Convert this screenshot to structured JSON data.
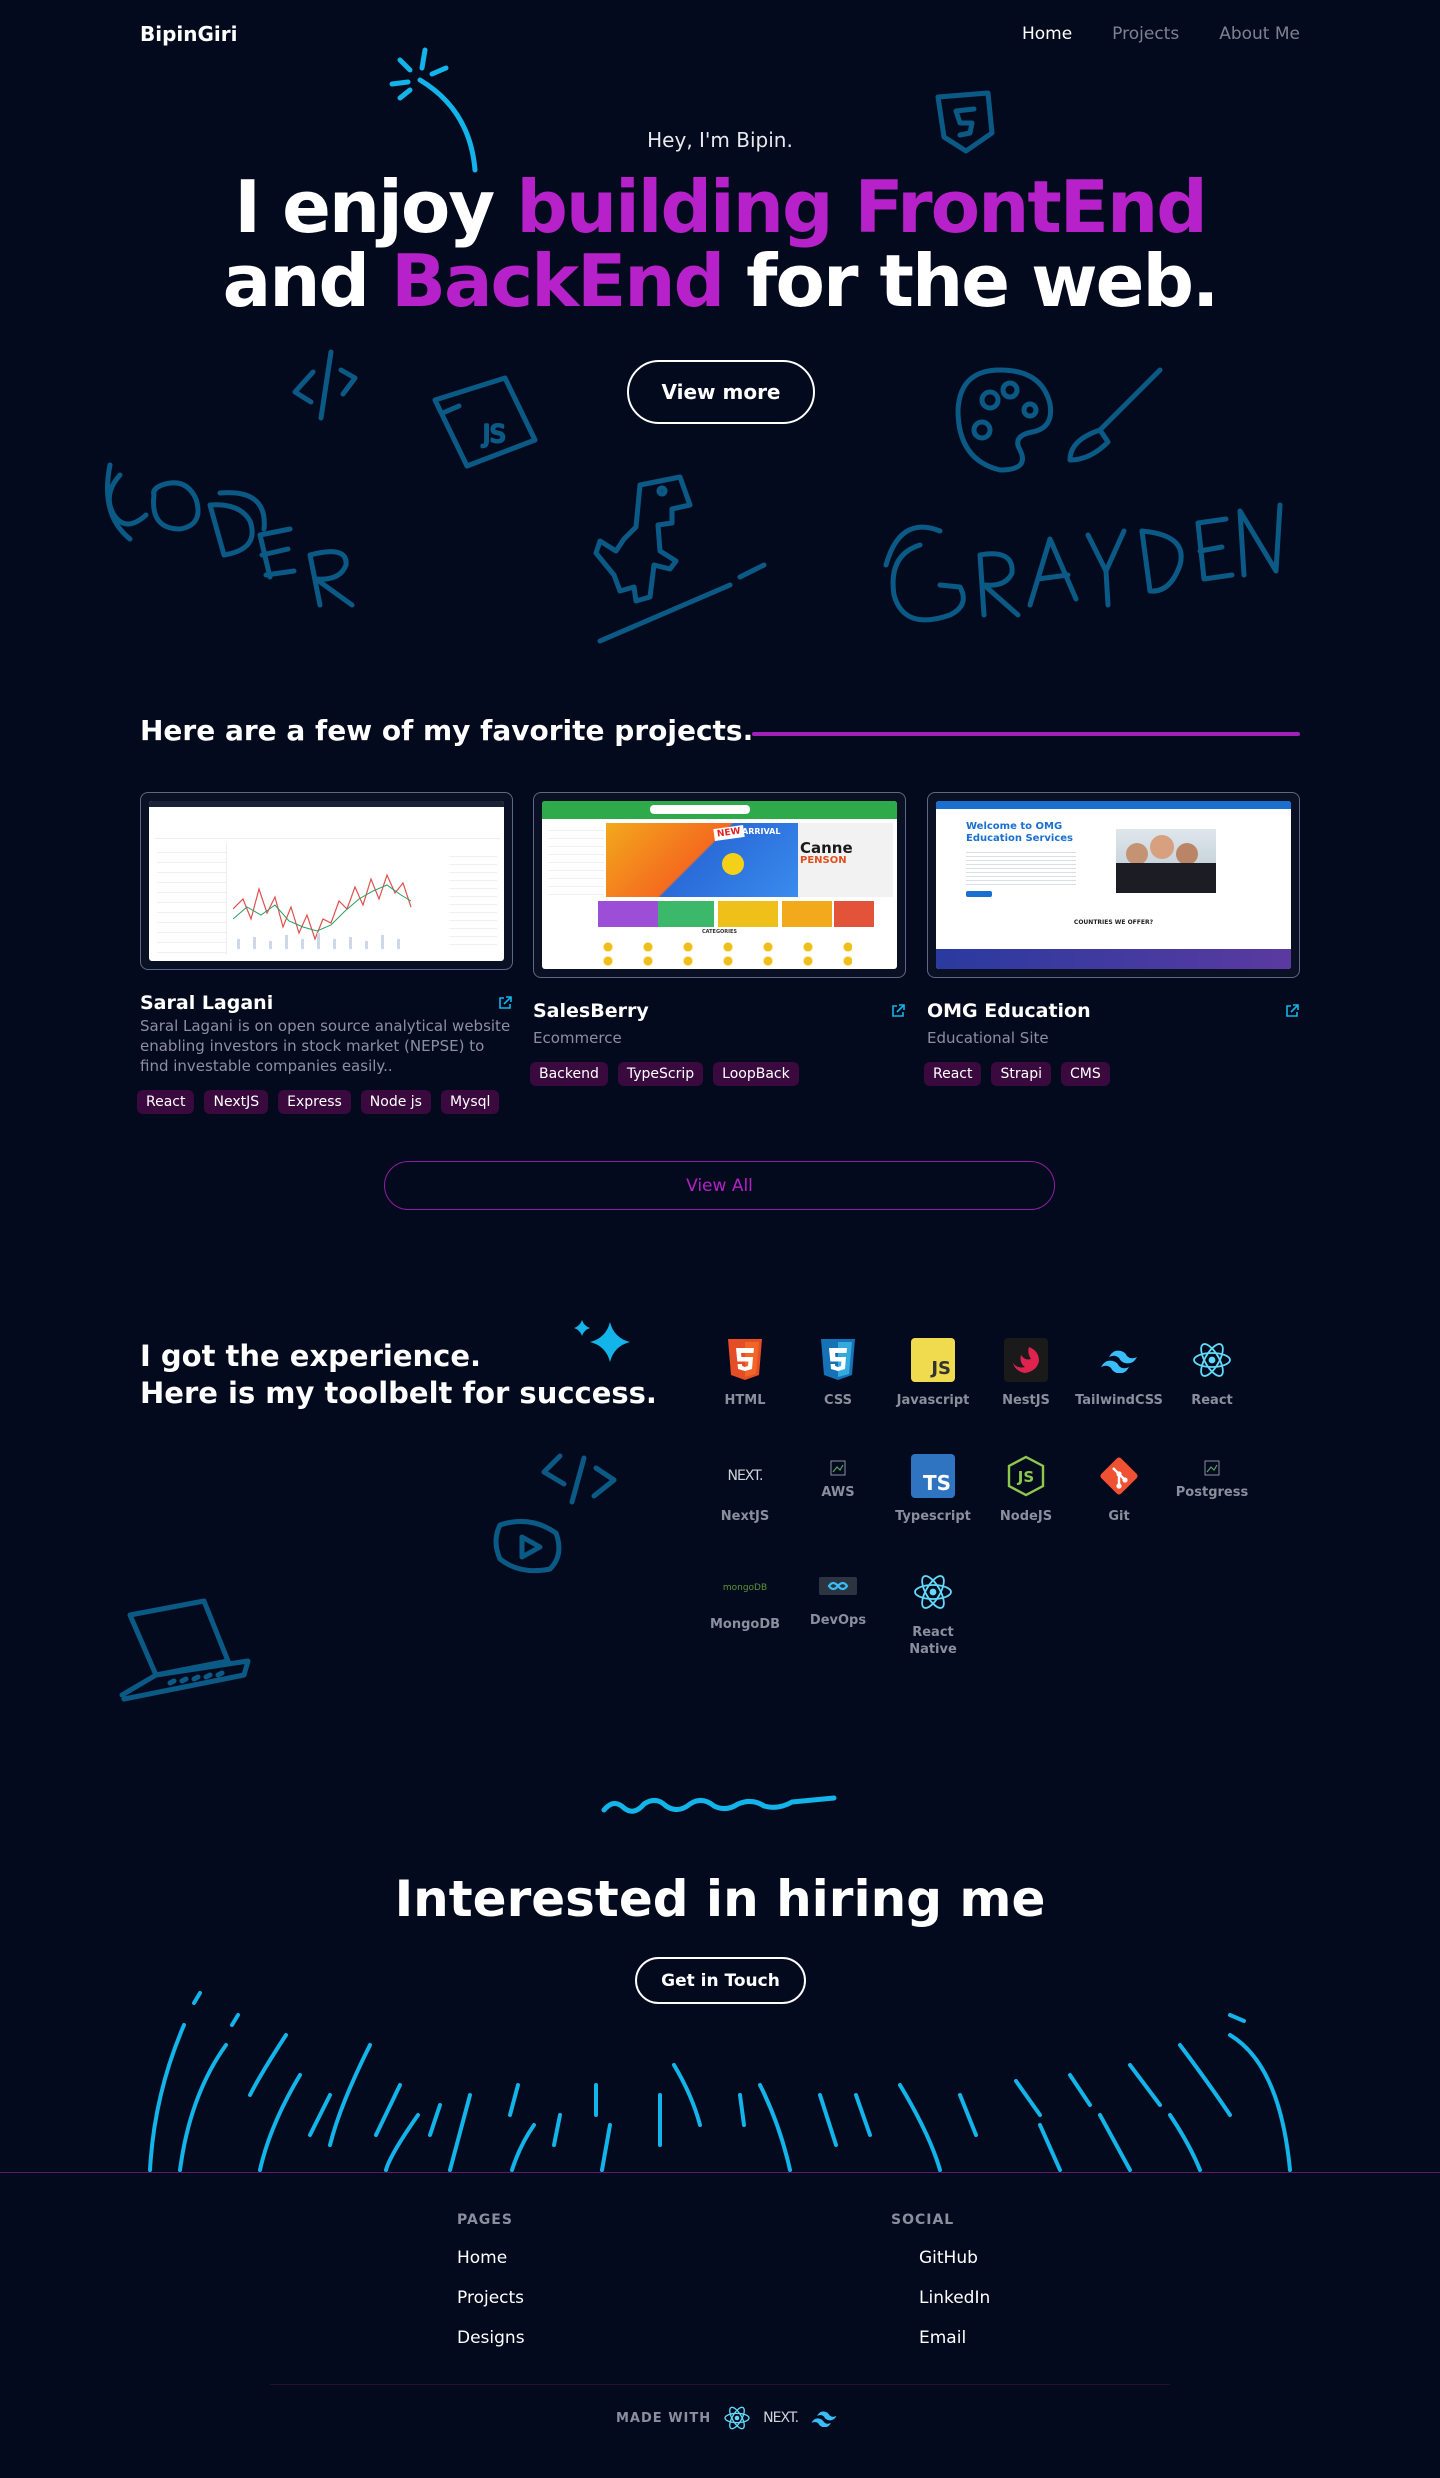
{
  "nav": {
    "logo": "BipinGiri",
    "links": [
      "Home",
      "Projects",
      "About Me"
    ]
  },
  "hero": {
    "greeting": "Hey, I'm Bipin.",
    "title_part1": "I enjoy ",
    "title_accent1": "building FrontEnd",
    "title_part2": "and ",
    "title_accent2": "BackEnd",
    "title_part3": " for the web.",
    "button": "View more",
    "accent_color": "#b721c9"
  },
  "projects": {
    "heading": "Here are a few of my favorite projects.",
    "items": [
      {
        "title": "Saral Lagani",
        "subtitle": "Saral Lagani is on open source analytical website enabling investors in stock market (NEPSE) to find investable companies easily..",
        "tags": [
          "React",
          "NextJS",
          "Express",
          "Node js",
          "Mysql"
        ]
      },
      {
        "title": "SalesBerry",
        "subtitle": "Ecommerce",
        "tags": [
          "Backend",
          "TypeScrip",
          "LoopBack"
        ]
      },
      {
        "title": "OMG Education",
        "subtitle": "Educational Site",
        "tags": [
          "React",
          "Strapi",
          "CMS"
        ]
      }
    ],
    "view_all": "View All",
    "shot_texts": {
      "salesberry_new": "NEW",
      "salesberry_arrival": "ARRIVAL",
      "salesberry_brand": "Canne",
      "salesberry_brand2": "PENSON",
      "salesberry_categories": "CATEGORIES",
      "omg_welcome": "Welcome to OMG",
      "omg_services": "Education Services",
      "omg_countries": "COUNTRIES WE OFFER?"
    }
  },
  "toolbelt": {
    "line1": "I got the experience.",
    "line2": "Here is my toolbelt for success.",
    "tools": [
      {
        "name": "HTML",
        "icon": "html5-icon"
      },
      {
        "name": "CSS",
        "icon": "css3-icon"
      },
      {
        "name": "Javascript",
        "icon": "javascript-icon"
      },
      {
        "name": "NestJS",
        "icon": "nestjs-icon"
      },
      {
        "name": "TailwindCSS",
        "icon": "tailwind-icon"
      },
      {
        "name": "React",
        "icon": "react-icon"
      },
      {
        "name": "NextJS",
        "icon": "nextjs-icon"
      },
      {
        "name": "AWS",
        "icon": "aws-icon"
      },
      {
        "name": "Typescript",
        "icon": "typescript-icon"
      },
      {
        "name": "NodeJS",
        "icon": "nodejs-icon"
      },
      {
        "name": "Git",
        "icon": "git-icon"
      },
      {
        "name": "Postgress",
        "icon": "postgres-icon"
      },
      {
        "name": "MongoDB",
        "icon": "mongodb-icon"
      },
      {
        "name": "DevOps",
        "icon": "devops-icon"
      },
      {
        "name": "React Native",
        "icon": "react-icon"
      }
    ],
    "icon_texts": {
      "js": "JS",
      "ts": "TS",
      "next": "NEXT.",
      "mongo": "mongoDB"
    }
  },
  "hire": {
    "title": "Interested in hiring me",
    "button": "Get in Touch"
  },
  "footer": {
    "pages_heading": "PAGES",
    "pages": [
      "Home",
      "Projects",
      "Designs"
    ],
    "social_heading": "SOCIAL",
    "social": [
      "GitHub",
      "LinkedIn",
      "Email"
    ],
    "made_with": "MADE WITH",
    "next_text": "NEXT."
  },
  "colors": {
    "background": "#040a1d",
    "accent": "#b721c9",
    "doodle": "#0b5a86",
    "cyan": "#12b4ea",
    "tag_bg": "#3a0a3e"
  }
}
